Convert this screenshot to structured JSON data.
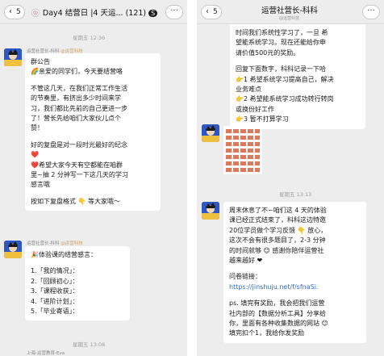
{
  "left": {
    "nav": {
      "back_count": "5",
      "title": "Day4 结营日 |4 天运...",
      "member_count": "(121)",
      "more_icon": "ellipsis-icon"
    },
    "timestamp1": "星期五 12:36",
    "msg1": {
      "sender": "运营社营长-科科",
      "sender_tag": "@运营科技",
      "lines": [
        "群公告",
        "亲爱的同学们，今天要结营咯",
        "",
        "不管这几天，在我们正常工作生活",
        "的节奏里，有挤出多少时间来学",
        "习，我们都比先前的自己更进一步",
        "了！营长先给咱们大家伙儿点个",
        "赞！",
        "",
        "好的复盘是对一段时光最好的纪念",
        "",
        "希望大家今天有空都能在咱群",
        "里~抽 2 分钟写一下这几天的学习",
        "感言哦",
        "",
        "按如下复盘格式 👇 等大家哦～"
      ]
    },
    "msg2": {
      "sender": "运营社营长-科科",
      "sender_tag": "@运营科技",
      "lines": [
        "体验课的结营感言：",
        "",
        "1.「我的情况」：",
        "2.「回顾初心」：",
        "3.「课程收获」：",
        "4.「进阶计划」：",
        "5.「毕业寄语」："
      ]
    },
    "timestamp2": "星期五 13:08",
    "next_sender": "上海-运营教育-Eva"
  },
  "right": {
    "nav": {
      "back_count": "5",
      "title": "运营社营长-科科",
      "subtitle": "@运营科技",
      "more_icon": "ellipsis-icon"
    },
    "msg1": {
      "lines": [
        "时间我们系统性学习了，一旦 希",
        "望能系统学习。现在还能给你申",
        "请价值500元的奖励。",
        "",
        "回复下面数字，科科记录一下哈",
        "1 希望系统学习提高自己，解决",
        "业务难点",
        "2 希望能系统学习成功转行转岗",
        "或换份好工作",
        "3 暂不打算学习"
      ]
    },
    "timestamp": "星期五 13:13",
    "msg2": {
      "lines": [
        "周末休息了不~咱们这 4 天的体验",
        "课已经正式结束了，科科这边特邀",
        "20位学员做个学习反馈 👇 放心，",
        "这次不会有很多题目了，2-3 分钟",
        "的时间就够 😊 感谢你陪伴运营社",
        "越来越好 ❤",
        "",
        "问卷链接：",
        "https://jinshuju.net/f/sfnaSi.",
        "",
        "ps. 填完有奖励，我会把我们运营",
        "社内部的【数据分析工具】分享给",
        "你，里面有各种收集数据的网站 😊",
        "填完扣个1，我给你发奖励"
      ]
    }
  }
}
